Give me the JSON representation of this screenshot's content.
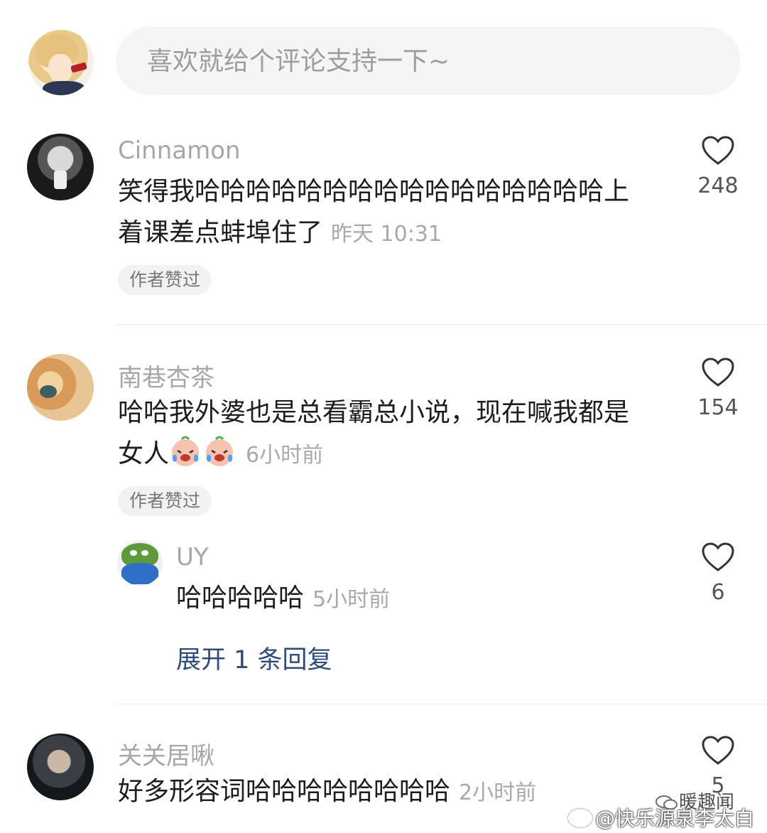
{
  "composer": {
    "placeholder": "喜欢就给个评论支持一下~"
  },
  "comments": [
    {
      "username": "Cinnamon",
      "content_line1": "笑得我哈哈哈哈哈哈哈哈哈哈哈哈哈哈哈哈上",
      "content_line2": "着课差点蚌埠住了",
      "time": "昨天 10:31",
      "likes": "248",
      "badge": "作者赞过"
    },
    {
      "username": "南巷杏茶",
      "content_line1": "哈哈我外婆也是总看霸总小说，现在喊我都是",
      "content_line2": "女人",
      "emojis": [
        "crying-laughing-emoji",
        "crying-laughing-emoji"
      ],
      "time": "6小时前",
      "likes": "154",
      "badge": "作者赞过",
      "reply": {
        "username": "UY",
        "content": "哈哈哈哈哈",
        "time": "5小时前",
        "likes": "6"
      },
      "expand_label": "展开 1 条回复"
    },
    {
      "username": "关关居啾",
      "content": "好多形容词哈哈哈哈哈哈哈哈",
      "time": "2小时前",
      "likes": "5"
    }
  ],
  "watermark": {
    "wechat": "暖趣闻",
    "weibo": "@快乐源泉李太白"
  }
}
